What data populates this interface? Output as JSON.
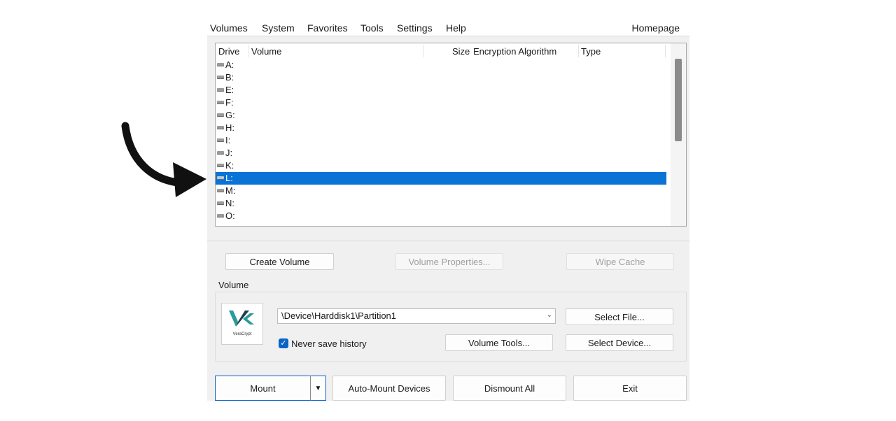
{
  "menu": {
    "volumes": "Volumes",
    "system": "System",
    "favorites": "Favorites",
    "tools": "Tools",
    "settings": "Settings",
    "help": "Help",
    "homepage": "Homepage"
  },
  "list": {
    "columns": {
      "drive": "Drive",
      "volume": "Volume",
      "size": "Size",
      "encryption": "Encryption Algorithm",
      "type": "Type"
    },
    "drives": [
      "A:",
      "B:",
      "E:",
      "F:",
      "G:",
      "H:",
      "I:",
      "J:",
      "K:",
      "L:",
      "M:",
      "N:",
      "O:"
    ],
    "selected_drive": "L:"
  },
  "buttons": {
    "create_volume": "Create Volume",
    "volume_properties": "Volume Properties...",
    "wipe_cache": "Wipe Cache",
    "select_file": "Select File...",
    "volume_tools": "Volume Tools...",
    "select_device": "Select Device...",
    "mount": "Mount",
    "auto_mount": "Auto-Mount Devices",
    "dismount_all": "Dismount All",
    "exit": "Exit"
  },
  "volume": {
    "group_label": "Volume",
    "path": "\\Device\\Harddisk1\\Partition1",
    "never_save_history": "Never save history",
    "never_save_history_checked": true,
    "logo_text": "VeraCrypt"
  },
  "colors": {
    "selection": "#0a73d6",
    "checkbox": "#0a63c7",
    "logo_teal": "#2a9a9a",
    "logo_dark": "#1c3f4f"
  },
  "icons": {
    "drive": "drive-icon",
    "arrow": "curved-arrow-icon",
    "logo": "veracrypt-logo-icon"
  }
}
